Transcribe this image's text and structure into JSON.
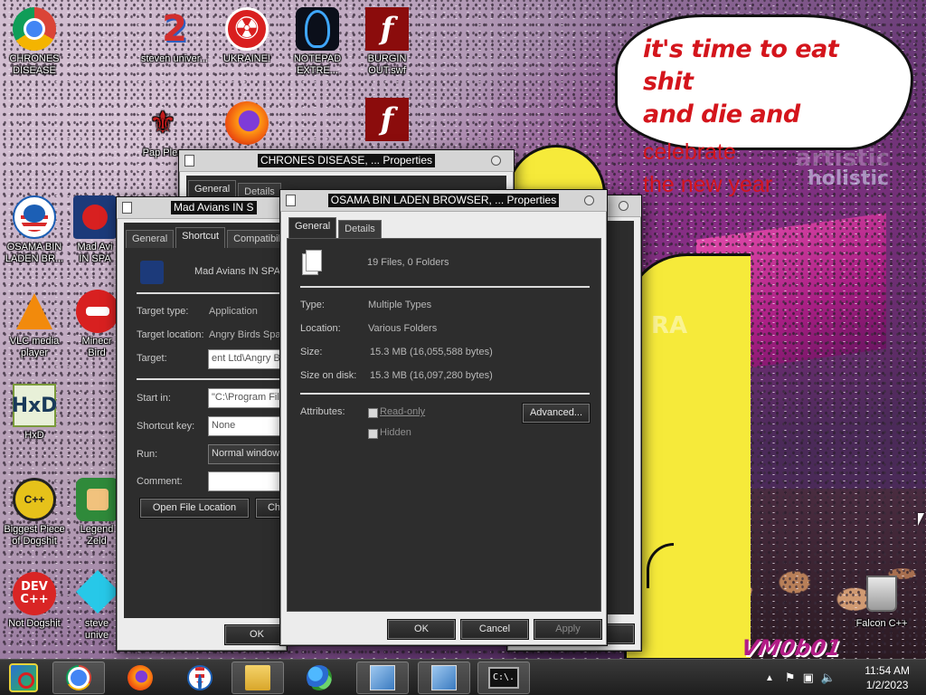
{
  "wallpaper": {
    "speech_bubble": {
      "line1": "it's time to eat shit",
      "line2_bold": "and die and",
      "line2_light": "celebrate",
      "line3": "the new year",
      "color": "#d4151c"
    },
    "bg_words": [
      "artistic",
      "holistic",
      "RA"
    ],
    "sticker": "VM0b01"
  },
  "desktop_icons": [
    {
      "label": "CHRONES DISEASE",
      "icon": "chrome-icon"
    },
    {
      "label": "steven univer...",
      "icon": "steven-universe-icon"
    },
    {
      "label": "UKRAINE!",
      "icon": "radiation-icon"
    },
    {
      "label": "NOTEPAD EXTRE...",
      "icon": "notepad-icon"
    },
    {
      "label": "BURGIN OUT.swf",
      "icon": "flash-icon"
    },
    {
      "label": "Pap Plea",
      "icon": "papers-please-icon"
    },
    {
      "label": "",
      "icon": "firefox-icon"
    },
    {
      "label": "",
      "icon": "flash-icon"
    },
    {
      "label": "OSAMA BIN LADEN BR...",
      "icon": "obama-logo-icon"
    },
    {
      "label": "Mad Avi IN SPA",
      "icon": "angry-birds-space-icon"
    },
    {
      "label": "VLC media player",
      "icon": "vlc-icon"
    },
    {
      "label": "Minecr Bird",
      "icon": "angry-bird-icon"
    },
    {
      "label": "HxD",
      "icon": "hxd-icon"
    },
    {
      "label": "Biggest Piece of Dogshit",
      "icon": "dogshit-icon"
    },
    {
      "label": "Legend Zeld",
      "icon": "zelda-icon"
    },
    {
      "label": "Not Dogshit",
      "icon": "devcpp-icon"
    },
    {
      "label": "steve unive",
      "icon": "diamond-icon"
    },
    {
      "label": "Falcon C++",
      "icon": "recycle-bin-icon"
    }
  ],
  "window_back": {
    "title": "CHRONES DISEASE, ... Properties",
    "tabs": [
      "General",
      "Details"
    ]
  },
  "window_shortcut": {
    "title": "Mad Avians IN S",
    "tabs": [
      "General",
      "Shortcut",
      "Compatibili"
    ],
    "name": "Mad Avians IN SPA",
    "target_type_label": "Target type:",
    "target_type_value": "Application",
    "target_location_label": "Target location:",
    "target_location_value": "Angry Birds Spa",
    "target_label": "Target:",
    "target_value": "ent Ltd\\Angry Bi",
    "start_in_label": "Start in:",
    "start_in_value": "\"C:\\Program File",
    "shortcut_key_label": "Shortcut key:",
    "shortcut_key_value": "None",
    "run_label": "Run:",
    "run_value": "Normal window",
    "comment_label": "Comment:",
    "comment_value": "",
    "open_location_button": "Open File Location",
    "change_icon_button": "Ch",
    "ok_button": "OK"
  },
  "window_main": {
    "title": "OSAMA BIN LADEN BROWSER, ... Properties",
    "tabs": [
      "General",
      "Details"
    ],
    "summary": "19 Files, 0 Folders",
    "type_label": "Type:",
    "type_value": "Multiple Types",
    "location_label": "Location:",
    "location_value": "Various Folders",
    "size_label": "Size:",
    "size_value": "15.3 MB (16,055,588 bytes)",
    "size_on_disk_label": "Size on disk:",
    "size_on_disk_value": "15.3 MB (16,097,280 bytes)",
    "attributes_label": "Attributes:",
    "readonly_label": "Read-only",
    "hidden_label": "Hidden",
    "advanced_button": "Advanced...",
    "ok_button": "OK",
    "cancel_button": "Cancel",
    "apply_button": "Apply"
  },
  "taskbar": {
    "apps": [
      "start-orb-icon",
      "chrome-icon",
      "firefox-icon",
      "obama-logo-icon",
      "file-explorer-icon",
      "people-icon",
      "setup-icon",
      "setup-icon",
      "command-prompt-icon"
    ],
    "cmd_glyph": "C:\\.",
    "time": "11:54 AM",
    "date": "1/2/2023"
  }
}
